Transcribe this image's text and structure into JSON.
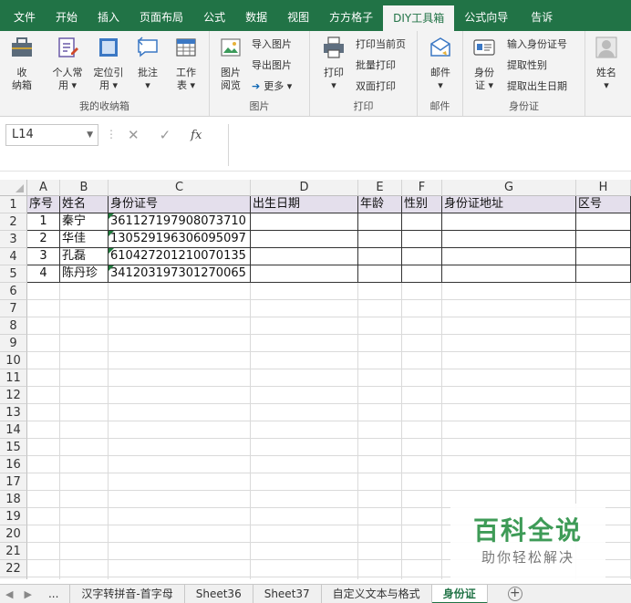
{
  "ribbon_tabs": [
    "文件",
    "开始",
    "插入",
    "页面布局",
    "公式",
    "数据",
    "视图",
    "方方格子",
    "DIY工具箱",
    "公式向导",
    "告诉"
  ],
  "ribbon": {
    "collect_group": {
      "label": "我的收纳箱",
      "storage_box": "收\n纳箱",
      "personal": "个人常\n用 ▾",
      "locate": "定位引\n用 ▾",
      "comment": "批注\n▾",
      "worksheet": "工作\n表 ▾"
    },
    "picture_group": {
      "label": "图片",
      "picture_view": "图片\n阅览",
      "import_picture": "导入图片",
      "export_picture": "导出图片",
      "more": "更多 ▾"
    },
    "print_group": {
      "label": "打印",
      "print": "打印\n▾",
      "print_current_page": "打印当前页",
      "batch_print": "批量打印",
      "duplex_print": "双面打印"
    },
    "mail_group": {
      "label": "邮件",
      "mail": "邮件\n▾"
    },
    "id_group": {
      "label": "身份证",
      "id_card": "身份\n证 ▾",
      "input_id": "输入身份证号",
      "extract_gender": "提取性别",
      "extract_birth": "提取出生日期"
    },
    "name_group": {
      "name": "姓名\n▾"
    }
  },
  "formula_bar": {
    "name_box": "L14",
    "fx": "fx",
    "cancel": "✕",
    "confirm": "✓",
    "value": ""
  },
  "columns": [
    "A",
    "B",
    "C",
    "D",
    "E",
    "F",
    "G",
    "H"
  ],
  "rows": [
    "1",
    "2",
    "3",
    "4",
    "5",
    "6",
    "7",
    "8",
    "9",
    "10",
    "11",
    "12",
    "13",
    "14",
    "15",
    "16",
    "17",
    "18",
    "19",
    "20",
    "21",
    "22",
    "23"
  ],
  "table": {
    "headers": [
      "序号",
      "姓名",
      "身份证号",
      "出生日期",
      "年龄",
      "性别",
      "身份证地址",
      "区号"
    ],
    "data": [
      [
        "1",
        "秦宁",
        "361127197908073710",
        "",
        "",
        "",
        "",
        ""
      ],
      [
        "2",
        "华佳",
        "130529196306095097",
        "",
        "",
        "",
        "",
        ""
      ],
      [
        "3",
        "孔磊",
        "610427201210070135",
        "",
        "",
        "",
        "",
        ""
      ],
      [
        "4",
        "陈丹珍",
        "341203197301270065",
        "",
        "",
        "",
        "",
        ""
      ]
    ]
  },
  "sheets": [
    "...",
    "汉字转拼音-首字母",
    "Sheet36",
    "Sheet37",
    "自定义文本与格式",
    "身份证"
  ],
  "active_sheet": "身份证",
  "watermark": {
    "title": "百科全说",
    "subtitle": "助你轻松解决"
  },
  "colors": {
    "excel_green": "#217346",
    "header_fill": "#e4dfec"
  }
}
